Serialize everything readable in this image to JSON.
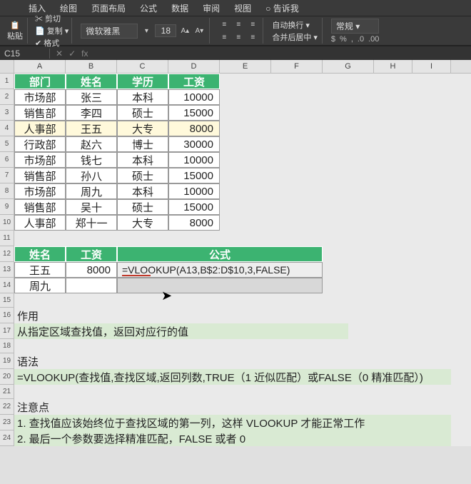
{
  "ribbon": {
    "tabs": [
      "插入",
      "绘图",
      "页面布局",
      "公式",
      "数据",
      "审阅",
      "视图",
      "○ 告诉我"
    ],
    "paste_label": "粘贴",
    "cut_label": "✂ 剪切",
    "copy_label": "📄 复制 ▾",
    "fmt_label": "✔ 格式",
    "font_name": "微软雅黑",
    "font_size": "18",
    "wrap_label": "自动换行 ▾",
    "merge_label": "合并后居中 ▾",
    "number_format": "常规"
  },
  "formula_bar": {
    "name_box": "C15",
    "fx": "fx",
    "value": ""
  },
  "columns": [
    "A",
    "B",
    "C",
    "D",
    "E",
    "F",
    "G",
    "H",
    "I"
  ],
  "table1": {
    "headers": [
      "部门",
      "姓名",
      "学历",
      "工资"
    ],
    "rows": [
      {
        "dept": "市场部",
        "name": "张三",
        "edu": "本科",
        "salary": "10000"
      },
      {
        "dept": "销售部",
        "name": "李四",
        "edu": "硕士",
        "salary": "15000"
      },
      {
        "dept": "人事部",
        "name": "王五",
        "edu": "大专",
        "salary": "8000",
        "highlight": true
      },
      {
        "dept": "行政部",
        "name": "赵六",
        "edu": "博士",
        "salary": "30000"
      },
      {
        "dept": "市场部",
        "name": "钱七",
        "edu": "本科",
        "salary": "10000"
      },
      {
        "dept": "销售部",
        "name": "孙八",
        "edu": "硕士",
        "salary": "15000"
      },
      {
        "dept": "市场部",
        "name": "周九",
        "edu": "本科",
        "salary": "10000"
      },
      {
        "dept": "销售部",
        "name": "吴十",
        "edu": "硕士",
        "salary": "15000"
      },
      {
        "dept": "人事部",
        "name": "郑十一",
        "edu": "大专",
        "salary": "8000"
      }
    ]
  },
  "table2": {
    "headers": [
      "姓名",
      "工资",
      "公式"
    ],
    "rows": [
      {
        "name": "王五",
        "salary": "8000",
        "formula": "=VLOOKUP(A13,B$2:D$10,3,FALSE)"
      },
      {
        "name": "周九",
        "salary": "",
        "formula": ""
      }
    ]
  },
  "notes": {
    "s1_head": "作用",
    "s1_body": "从指定区域查找值，返回对应行的值",
    "s2_head": "语法",
    "s2_body": "=VLOOKUP(查找值,查找区域,返回列数,TRUE（1 近似匹配）或FALSE（0 精准匹配）)",
    "s3_head": "注意点",
    "s3_item1": "1. 查找值应该始终位于查找区域的第一列，这样 VLOOKUP 才能正常工作",
    "s3_item2": "2. 最后一个参数要选择精准匹配，FALSE 或者 0"
  }
}
